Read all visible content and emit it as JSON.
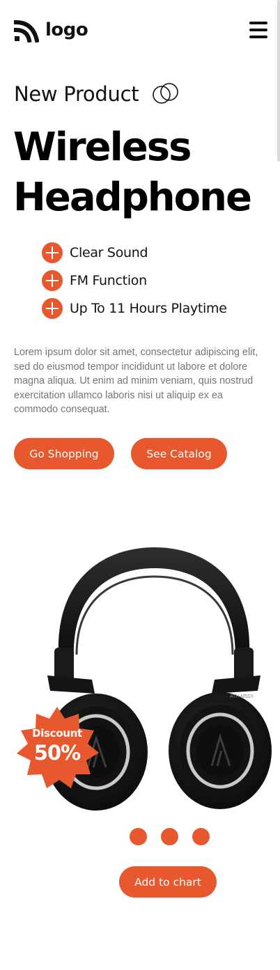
{
  "header": {
    "logo_text": "logo",
    "menu_icon": "hamburger-menu-icon"
  },
  "hero": {
    "eyebrow": "New Product",
    "eyebrow_icon": "overlapping-circles-icon",
    "title_line1": "Wireless",
    "title_line2": "Headphone",
    "features": [
      {
        "icon": "plus-circle-icon",
        "label": "Clear Sound"
      },
      {
        "icon": "plus-circle-icon",
        "label": "FM Function"
      },
      {
        "icon": "plus-circle-icon",
        "label": "Up To 11 Hours Playtime"
      }
    ],
    "description": "Lorem ipsum dolor sit amet, consectetur adipiscing elit, sed do eiusmod tempor incididunt ut labore et dolore magna aliqua. Ut enim ad minim veniam, quis nostrud exercitation ullamco laboris nisi ut aliquip ex ea commodo consequat.",
    "primary_button": "Go Shopping",
    "secondary_button": "See Catalog"
  },
  "product": {
    "image": "black-over-ear-headphones",
    "ear_cup_print": "ATH-M50X",
    "badge_label": "Discount",
    "badge_value": "50%",
    "carousel_dots": 3,
    "cart_button": "Add to chart"
  },
  "colors": {
    "accent": "#e8582e",
    "text": "#111111",
    "muted": "#757575",
    "background": "#ffffff"
  }
}
